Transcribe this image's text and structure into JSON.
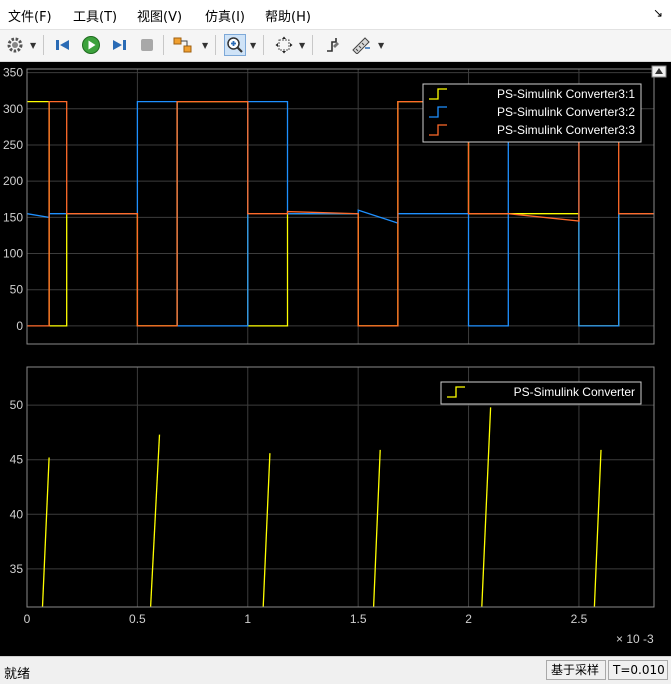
{
  "menubar": {
    "items": [
      "文件(F)",
      "工具(T)",
      "视图(V)",
      "仿真(I)",
      "帮助(H)"
    ],
    "undock_symbol": "↘"
  },
  "toolbar": {
    "buttons": [
      "settings",
      "step-back",
      "run",
      "step-forward",
      "stop",
      "highlight",
      "zoom-in",
      "scale-axes",
      "triggers",
      "measurement"
    ]
  },
  "status": {
    "text": "就绪",
    "sample_mode": "基于采样",
    "time": "T=0.010"
  },
  "colors": {
    "series1": "#ffff00",
    "series2": "#1e90ff",
    "series3": "#ff6a2a",
    "axes_bg": "#000000",
    "grid": "#3c3c3c"
  },
  "chart_data": [
    {
      "type": "line",
      "title": "",
      "xlabel": "",
      "ylabel": "",
      "xlim": [
        0,
        0.00284
      ],
      "ylim": [
        -25,
        355
      ],
      "yticks": [
        0,
        50,
        100,
        150,
        200,
        250,
        300,
        350
      ],
      "grid": true,
      "legend_position": "top-right",
      "series": [
        {
          "name": "PS-Simulink Converter3:1",
          "color": "#ffff00",
          "x": [
            0,
            0.0001,
            0.0001,
            0.00018,
            0.00018,
            0.0005,
            0.0005,
            0.00068,
            0.00068,
            0.001,
            0.001,
            0.00118,
            0.00118,
            0.0015,
            0.0015,
            0.00168,
            0.00168,
            0.002,
            0.002,
            0.00218,
            0.00218,
            0.0025,
            0.0025,
            0.00268,
            0.00268,
            0.00284
          ],
          "values": [
            310,
            310,
            0,
            0,
            155,
            155,
            0,
            0,
            310,
            310,
            0,
            0,
            155,
            155,
            0,
            0,
            310,
            310,
            155,
            155,
            155,
            155,
            0,
            0,
            155,
            155
          ]
        },
        {
          "name": "PS-Simulink Converter3:2",
          "color": "#1e90ff",
          "x": [
            0,
            0.0001,
            0.0001,
            0.00018,
            0.00018,
            0.0005,
            0.0005,
            0.00068,
            0.00068,
            0.001,
            0.001,
            0.00118,
            0.00118,
            0.0015,
            0.0015,
            0.00168,
            0.00168,
            0.002,
            0.002,
            0.00218,
            0.00218,
            0.0025,
            0.0025,
            0.00268,
            0.00268,
            0.00284
          ],
          "values": [
            155,
            150,
            155,
            155,
            155,
            155,
            310,
            310,
            0,
            0,
            310,
            310,
            155,
            155,
            160,
            142,
            155,
            155,
            0,
            0,
            310,
            310,
            0,
            0,
            155,
            155
          ]
        },
        {
          "name": "PS-Simulink Converter3:3",
          "color": "#ff6a2a",
          "x": [
            0,
            0.0001,
            0.0001,
            0.00018,
            0.00018,
            0.0005,
            0.0005,
            0.00068,
            0.00068,
            0.001,
            0.001,
            0.00118,
            0.00118,
            0.0015,
            0.0015,
            0.00168,
            0.00168,
            0.002,
            0.002,
            0.00218,
            0.00218,
            0.0025,
            0.0025,
            0.00268,
            0.00268,
            0.00284
          ],
          "values": [
            0,
            0,
            310,
            310,
            155,
            155,
            0,
            0,
            310,
            310,
            155,
            155,
            158,
            155,
            0,
            0,
            310,
            310,
            155,
            155,
            155,
            145,
            310,
            310,
            155,
            155
          ]
        }
      ]
    },
    {
      "type": "line",
      "title": "",
      "xlabel": "",
      "ylabel": "",
      "x_scale_label": "× 10 -3",
      "xlim": [
        0,
        0.00284
      ],
      "ylim": [
        31.5,
        53.5
      ],
      "xticks": [
        0,
        0.5,
        1,
        1.5,
        2,
        2.5
      ],
      "yticks": [
        35,
        40,
        45,
        50
      ],
      "grid": true,
      "legend_position": "top-right",
      "series": [
        {
          "name": "PS-Simulink Converter",
          "color": "#ffff00",
          "segments": [
            {
              "x": [
                7e-05,
                0.0001
              ],
              "values": [
                31.5,
                45.2
              ]
            },
            {
              "x": [
                0.00056,
                0.0006
              ],
              "values": [
                31.5,
                47.3
              ]
            },
            {
              "x": [
                0.00107,
                0.0011
              ],
              "values": [
                31.5,
                45.6
              ]
            },
            {
              "x": [
                0.00157,
                0.0016
              ],
              "values": [
                31.5,
                45.9
              ]
            },
            {
              "x": [
                0.00206,
                0.0021
              ],
              "values": [
                31.5,
                49.8
              ]
            },
            {
              "x": [
                0.00257,
                0.0026
              ],
              "values": [
                31.5,
                45.9
              ]
            }
          ]
        }
      ]
    }
  ]
}
